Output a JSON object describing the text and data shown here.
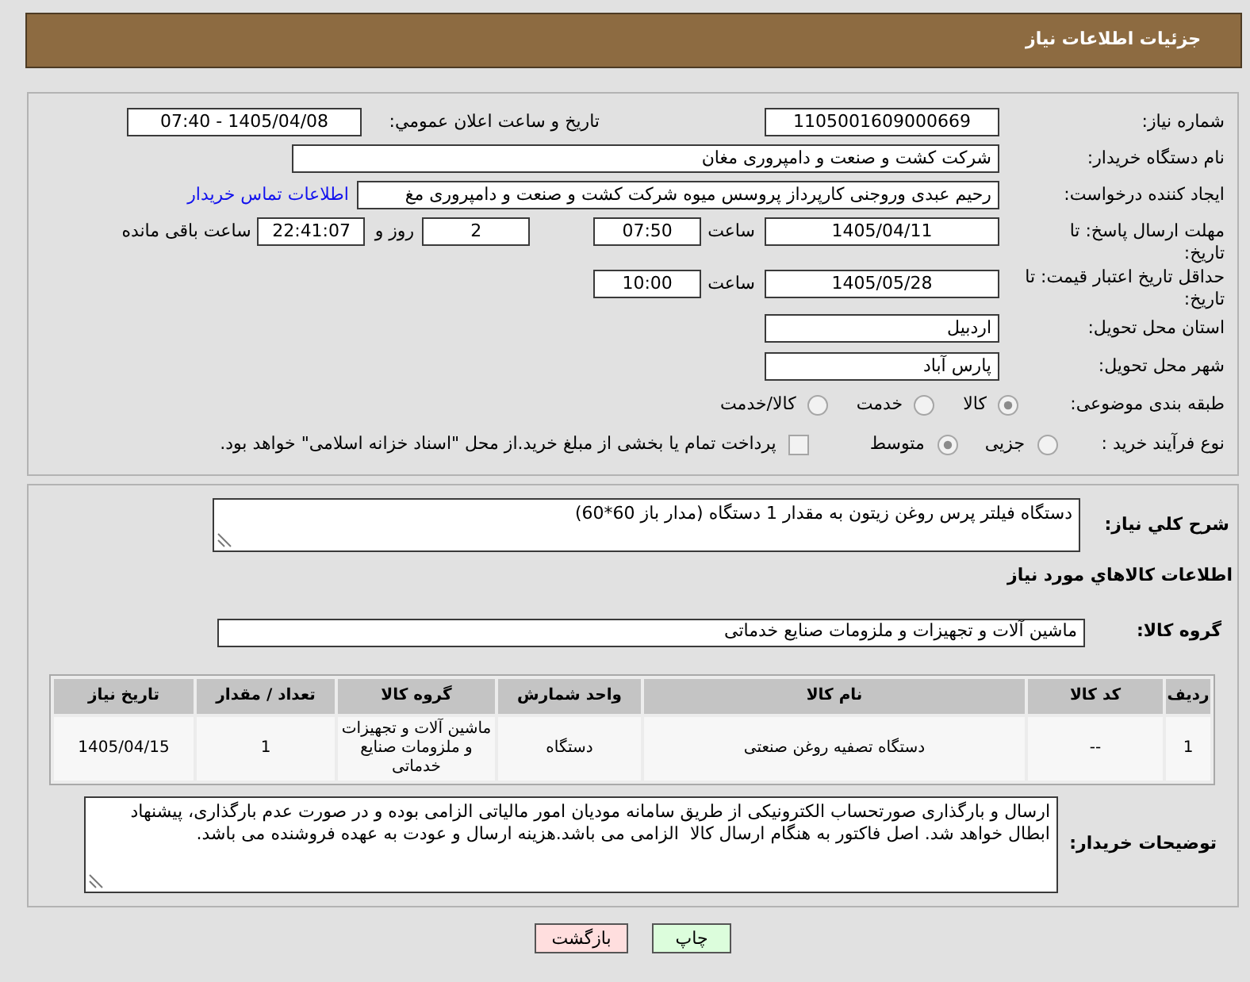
{
  "header": {
    "title": "جزئیات اطلاعات نیاز"
  },
  "need_number": {
    "label": "شماره نیاز:",
    "value": "1105001609000669"
  },
  "announcement": {
    "label": "تاریخ و ساعت اعلان عمومي:",
    "value": "1405/04/08 - 07:40"
  },
  "buyer_org": {
    "label": "نام دستگاه خریدار:",
    "value": "شرکت کشت و صنعت و دامپروری مغان"
  },
  "requester": {
    "label": "ایجاد کننده درخواست:",
    "value": "رحیم عبدی وروجنی کارپرداز پروسس میوه شرکت کشت و صنعت و دامپروری مغ",
    "contact_link": "اطلاعات تماس خریدار"
  },
  "response_deadline": {
    "label": "مهلت ارسال پاسخ: تا تاریخ:",
    "date": "1405/04/11",
    "time_label": "ساعت",
    "time": "07:50",
    "days": "2",
    "days_label": "روز و",
    "remaining": "22:41:07",
    "remaining_label": "ساعت باقی مانده"
  },
  "price_validity": {
    "label": "حداقل تاریخ اعتبار قیمت: تا تاریخ:",
    "date": "1405/05/28",
    "time_label": "ساعت",
    "time": "10:00"
  },
  "delivery_province": {
    "label": "استان محل تحویل:",
    "value": "اردبیل"
  },
  "delivery_city": {
    "label": "شهر محل تحویل:",
    "value": "پارس آباد"
  },
  "subject_category": {
    "label": "طبقه بندی موضوعی:",
    "options": [
      {
        "label": "کالا",
        "selected": true
      },
      {
        "label": "خدمت",
        "selected": false
      },
      {
        "label": "کالا/خدمت",
        "selected": false
      }
    ]
  },
  "purchase_process": {
    "label": "نوع فرآیند خرید :",
    "options": [
      {
        "label": "جزیی",
        "selected": false
      },
      {
        "label": "متوسط",
        "selected": true
      }
    ],
    "treasury_payment": {
      "label": "پرداخت تمام یا بخشی از مبلغ خرید.از محل \"اسناد خزانه اسلامی\" خواهد بود.",
      "checked": false
    }
  },
  "general_description": {
    "label": "شرح کلي نیاز:",
    "value": "دستگاه فیلتر پرس روغن زیتون به مقدار 1 دستگاه (مدار باز 60*60)"
  },
  "goods_section": {
    "title": "اطلاعات کالاهاي مورد نیاز"
  },
  "goods_group": {
    "label": "گروه کالا:",
    "value": "ماشین آلات و تجهیزات و ملزومات صنایع خدماتی"
  },
  "goods_table": {
    "columns": [
      "ردیف",
      "کد کالا",
      "نام کالا",
      "واحد شمارش",
      "گروه کالا",
      "تعداد / مقدار",
      "تاریخ نیاز"
    ],
    "rows": [
      {
        "cells": [
          "1",
          "--",
          "دستگاه تصفیه روغن صنعتی",
          "دستگاه",
          "ماشین آلات و تجهیزات و ملزومات صنایع خدماتی",
          "1",
          "1405/04/15"
        ]
      }
    ]
  },
  "buyer_notes": {
    "label": "توضیحات خریدار:",
    "value": "ارسال و بارگذاری صورتحساب الکترونیکی از طریق سامانه مودیان امور مالیاتی الزامی بوده و در صورت عدم بارگذاری، پیشنهاد ابطال خواهد شد. اصل فاکتور به هنگام ارسال کالا  الزامی می باشد.هزینه ارسال و عودت به عهده فروشنده می باشد."
  },
  "buttons": [
    {
      "label": "چاپ",
      "kind": "print"
    },
    {
      "label": "بازگشت",
      "kind": "back"
    }
  ]
}
